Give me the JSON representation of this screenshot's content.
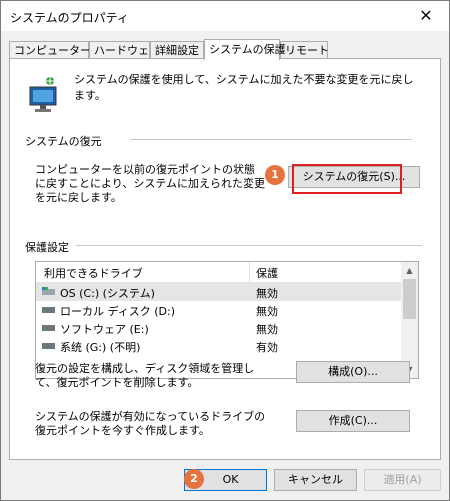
{
  "window": {
    "title": "システムのプロパティ",
    "close_glyph": "✕"
  },
  "tabs": [
    {
      "label": "コンピューター名"
    },
    {
      "label": "ハードウェア"
    },
    {
      "label": "詳細設定"
    },
    {
      "label": "システムの保護",
      "active": true
    },
    {
      "label": "リモート"
    }
  ],
  "intro": "システムの保護を使用して、システムに加えた不要な変更を元に戻します。",
  "restore": {
    "section_label": "システムの復元",
    "description": "コンピューターを以前の復元ポイントの状態に戻すことにより、システムに加えられた変更を元に戻します。",
    "button_label": "システムの復元(S)...",
    "badge": "1"
  },
  "protection": {
    "section_label": "保護設定",
    "columns": [
      "利用できるドライブ",
      "保護"
    ],
    "drives": [
      {
        "name": "OS (C:) (システム)",
        "status": "無効",
        "selected": true
      },
      {
        "name": "ローカル ディスク (D:)",
        "status": "無効"
      },
      {
        "name": "ソフトウェア (E:)",
        "status": "無効"
      },
      {
        "name": "系统 (G:) (不明)",
        "status": "有効"
      }
    ],
    "configure_desc": "復元の設定を構成し、ディスク領域を管理して、復元ポイントを削除します。",
    "configure_button": "構成(O)...",
    "create_desc": "システムの保護が有効になっているドライブの復元ポイントを今すぐ作成します。",
    "create_button": "作成(C)..."
  },
  "footer": {
    "ok": "OK",
    "cancel": "キャンセル",
    "apply": "適用(A)",
    "badge": "2"
  },
  "colors": {
    "highlight": "#e02020",
    "badge": "#e57340",
    "focus": "#0078d7"
  }
}
